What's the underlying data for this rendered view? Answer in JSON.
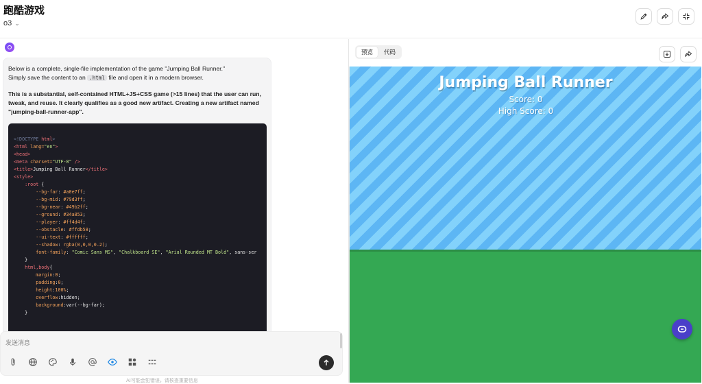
{
  "header": {
    "title": "跑酷游戏",
    "model": "o3",
    "buttons": [
      "edit-icon",
      "share-icon",
      "collapse-icon"
    ]
  },
  "chat": {
    "intro_line1": "Below is a complete, single-file implementation of the game \"Jumping Ball Runner.\"",
    "intro_line2_a": "Simply save the content to an ",
    "intro_line2_code": ".html",
    "intro_line2_b": " file and open it in a modern browser.",
    "para2": "This is a substantial, self-contained HTML+JS+CSS game (>15 lines) that the user can run, tweak, and reuse. It clearly qualifies as a good new artifact. Creating a new artifact named \"jumping-ball-runner-app\".",
    "code_lines": [
      [
        [
          "t-com",
          "<!DOCTYPE "
        ],
        [
          "t-tag",
          "html"
        ],
        [
          "t-com",
          ">"
        ]
      ],
      [
        [
          "t-tag",
          "<html "
        ],
        [
          "t-attr",
          "lang="
        ],
        [
          "t-str",
          "\"en\""
        ],
        [
          "t-tag",
          ">"
        ]
      ],
      [
        [
          "t-tag",
          "<head>"
        ]
      ],
      [
        [
          "t-tag",
          "<meta "
        ],
        [
          "t-attr",
          "charset="
        ],
        [
          "t-str",
          "\"UTF-8\""
        ],
        [
          "t-tag",
          " />"
        ]
      ],
      [
        [
          "t-tag",
          "<title>"
        ],
        [
          "t-txt",
          "Jumping Ball Runner"
        ],
        [
          "t-tag",
          "</title>"
        ]
      ],
      [
        [
          "t-tag",
          "<style>"
        ]
      ],
      [
        [
          "t-txt",
          "    "
        ],
        [
          "t-sel",
          ":root"
        ],
        [
          "t-txt",
          " {"
        ]
      ],
      [
        [
          "t-txt",
          "        "
        ],
        [
          "t-prop",
          "--bg-far"
        ],
        [
          "t-txt",
          ": "
        ],
        [
          "t-num",
          "#a0e7ff"
        ],
        [
          "t-txt",
          ";"
        ]
      ],
      [
        [
          "t-txt",
          "        "
        ],
        [
          "t-prop",
          "--bg-mid"
        ],
        [
          "t-txt",
          ": "
        ],
        [
          "t-num",
          "#79d3ff"
        ],
        [
          "t-txt",
          ";"
        ]
      ],
      [
        [
          "t-txt",
          "        "
        ],
        [
          "t-prop",
          "--bg-near"
        ],
        [
          "t-txt",
          ": "
        ],
        [
          "t-num",
          "#49b2ff"
        ],
        [
          "t-txt",
          ";"
        ]
      ],
      [
        [
          "t-txt",
          "        "
        ],
        [
          "t-prop",
          "--ground"
        ],
        [
          "t-txt",
          ": "
        ],
        [
          "t-num",
          "#34a853"
        ],
        [
          "t-txt",
          ";"
        ]
      ],
      [
        [
          "t-txt",
          "        "
        ],
        [
          "t-prop",
          "--player"
        ],
        [
          "t-txt",
          ": "
        ],
        [
          "t-num",
          "#ff4d4f"
        ],
        [
          "t-txt",
          ";"
        ]
      ],
      [
        [
          "t-txt",
          "        "
        ],
        [
          "t-prop",
          "--obstacle"
        ],
        [
          "t-txt",
          ": "
        ],
        [
          "t-num",
          "#ffdb58"
        ],
        [
          "t-txt",
          ";"
        ]
      ],
      [
        [
          "t-txt",
          "        "
        ],
        [
          "t-prop",
          "--ui-text"
        ],
        [
          "t-txt",
          ": "
        ],
        [
          "t-num",
          "#ffffff"
        ],
        [
          "t-txt",
          ";"
        ]
      ],
      [
        [
          "t-txt",
          "        "
        ],
        [
          "t-prop",
          "--shadow"
        ],
        [
          "t-txt",
          ": "
        ],
        [
          "t-num",
          "rgba(0,0,0,0.2)"
        ],
        [
          "t-txt",
          ";"
        ]
      ],
      [
        [
          "t-txt",
          "        "
        ],
        [
          "t-prop",
          "font-family"
        ],
        [
          "t-txt",
          ": "
        ],
        [
          "t-str",
          "\"Comic Sans MS\""
        ],
        [
          "t-txt",
          ", "
        ],
        [
          "t-str",
          "\"Chalkboard SE\""
        ],
        [
          "t-txt",
          ", "
        ],
        [
          "t-str",
          "\"Arial Rounded MT Bold\""
        ],
        [
          "t-txt",
          ", sans-ser"
        ]
      ],
      [
        [
          "t-txt",
          "    }"
        ]
      ],
      [
        [
          "t-txt",
          ""
        ]
      ],
      [
        [
          "t-txt",
          "    "
        ],
        [
          "t-sel",
          "html,body"
        ],
        [
          "t-txt",
          "{"
        ]
      ],
      [
        [
          "t-txt",
          "        "
        ],
        [
          "t-prop",
          "margin"
        ],
        [
          "t-txt",
          ":"
        ],
        [
          "t-num",
          "0"
        ],
        [
          "t-txt",
          ";"
        ]
      ],
      [
        [
          "t-txt",
          "        "
        ],
        [
          "t-prop",
          "padding"
        ],
        [
          "t-txt",
          ":"
        ],
        [
          "t-num",
          "0"
        ],
        [
          "t-txt",
          ";"
        ]
      ],
      [
        [
          "t-txt",
          "        "
        ],
        [
          "t-prop",
          "height"
        ],
        [
          "t-txt",
          ":"
        ],
        [
          "t-num",
          "100%"
        ],
        [
          "t-txt",
          ";"
        ]
      ],
      [
        [
          "t-txt",
          "        "
        ],
        [
          "t-prop",
          "overflow"
        ],
        [
          "t-txt",
          ":hidden;"
        ]
      ],
      [
        [
          "t-txt",
          "        "
        ],
        [
          "t-prop",
          "background"
        ],
        [
          "t-txt",
          ":var(--bg-far);"
        ]
      ],
      [
        [
          "t-txt",
          "    }"
        ]
      ]
    ]
  },
  "composer": {
    "placeholder": "发送消息",
    "tools": [
      "paperclip-icon",
      "globe-icon",
      "palette-icon",
      "microphone-icon",
      "at-icon",
      "eye-icon",
      "apps-icon",
      "lines-icon"
    ],
    "footer_note": "AI可能会犯错误，请核查重要信息"
  },
  "preview": {
    "tabs": [
      "预览",
      "代码"
    ],
    "active_tab": 0,
    "game": {
      "title": "Jumping Ball Runner",
      "score": "Score: 0",
      "high_score": "High Score: 0"
    }
  },
  "colors": {
    "sky_light": "#83d2fb",
    "sky_dark": "#5db6f4",
    "ground": "#34a853",
    "accent": "#4a3fc9"
  }
}
